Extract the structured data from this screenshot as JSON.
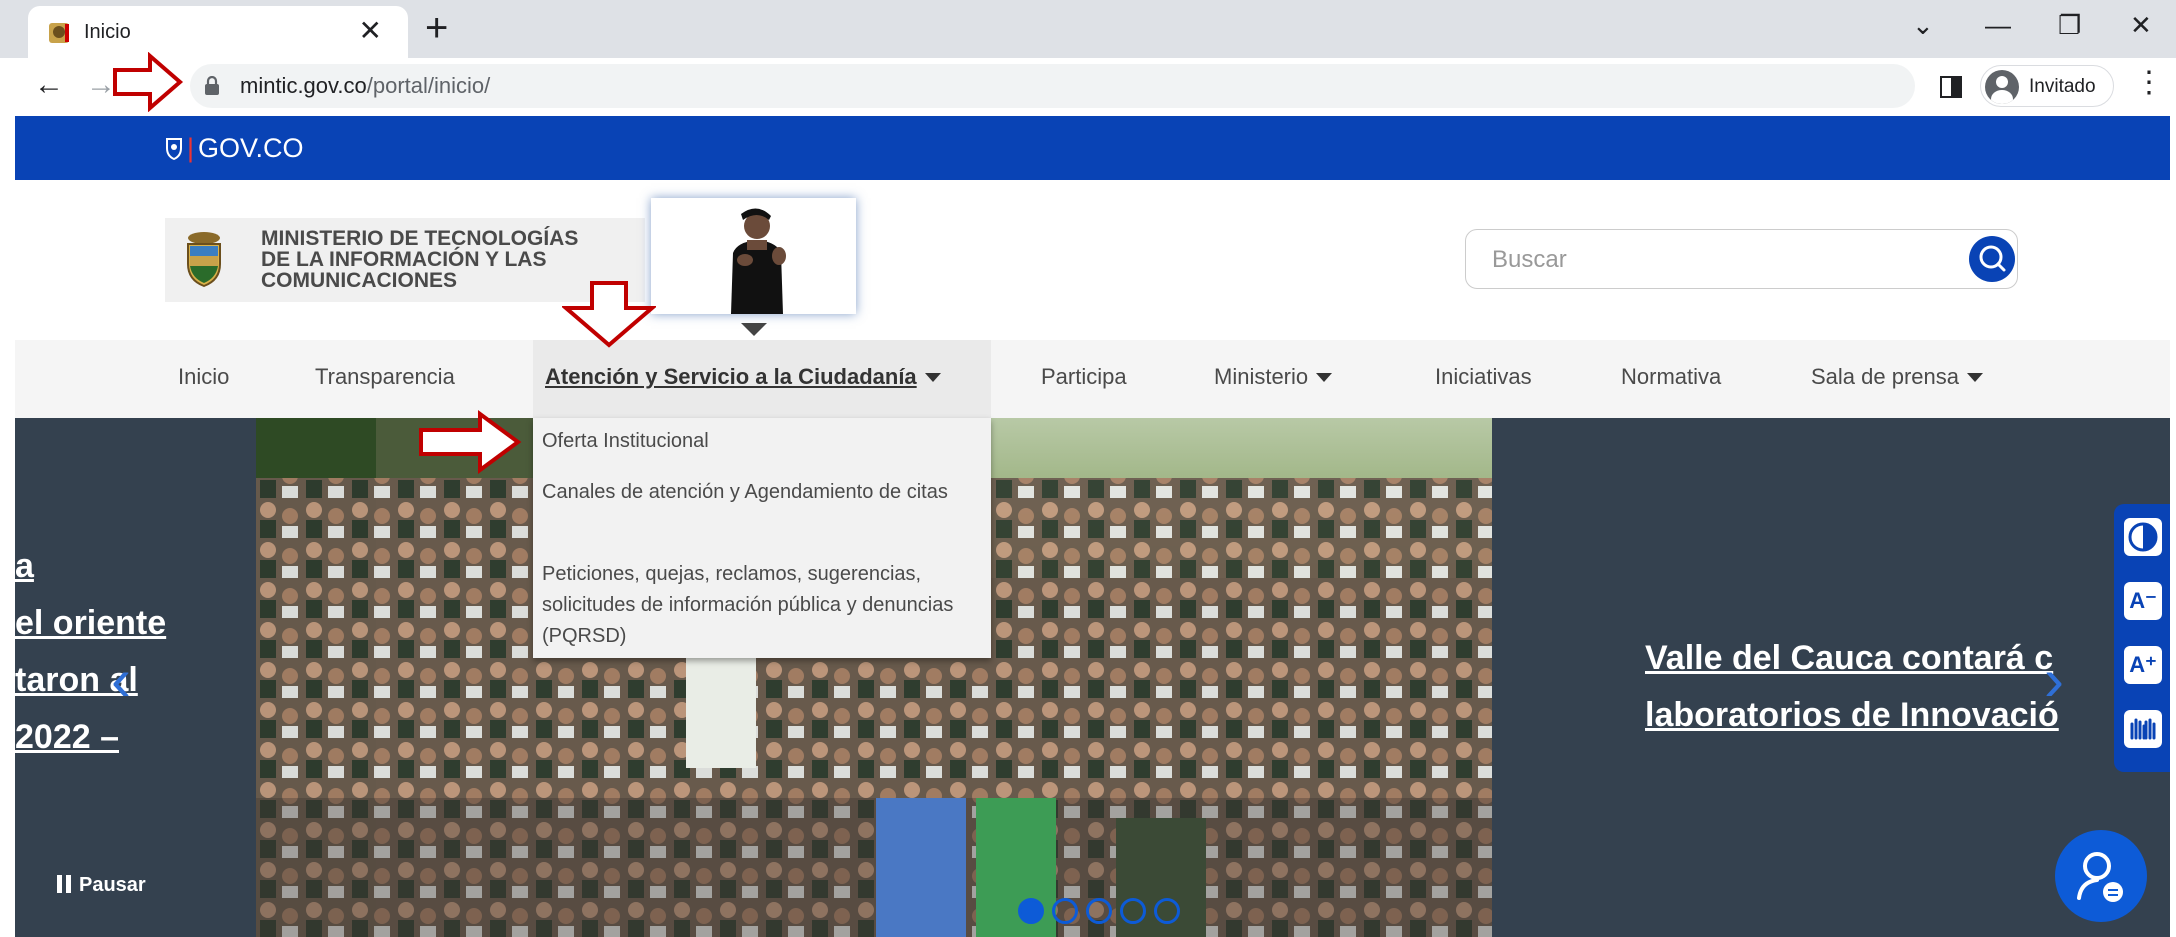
{
  "browser": {
    "tab_title": "Inicio",
    "tab_close": "✕",
    "new_tab": "+",
    "url_host": "mintic.gov.co",
    "url_path": "/portal/inicio/",
    "profile_label": "Invitado",
    "win_controls": [
      "⌄",
      "—",
      "❐",
      "✕"
    ]
  },
  "gov_bar": {
    "logo_text": "GOV.CO"
  },
  "header": {
    "ministry_name": [
      "MINISTERIO DE TECNOLOGÍAS",
      "DE LA INFORMACIÓN Y LAS",
      "COMUNICACIONES"
    ],
    "search_placeholder": "Buscar"
  },
  "nav": {
    "items": [
      {
        "label": "Inicio"
      },
      {
        "label": "Transparencia"
      },
      {
        "label": "Atención y Servicio a la Ciudadanía",
        "has_menu": true,
        "active": true
      },
      {
        "label": "Participa"
      },
      {
        "label": "Ministerio",
        "has_menu": true
      },
      {
        "label": "Iniciativas"
      },
      {
        "label": "Normativa"
      },
      {
        "label": "Sala de prensa",
        "has_menu": true
      }
    ]
  },
  "dropdown": {
    "items": [
      "Oferta Institucional",
      "Canales de atención y Agendamiento de citas",
      "Peticiones, quejas, reclamos, sugerencias, solicitudes de información pública y denuncias (PQRSD)"
    ]
  },
  "carousel": {
    "left_lines": [
      "a",
      "el oriente",
      "taron al",
      " 2022 –"
    ],
    "right_lines": [
      "Valle del Cauca contará c",
      "laboratorios de Innovació"
    ],
    "pause_label": "Pausar",
    "slide_count": 5,
    "active_slide": 1
  },
  "accessibility": {
    "buttons": [
      "contrast-icon",
      "decrease-font-icon",
      "increase-font-icon",
      "sign-language-icon"
    ],
    "decrease_label": "A⁻",
    "increase_label": "A⁺"
  },
  "colors": {
    "gov_blue": "#0943b5",
    "carousel_bg": "#34414f",
    "annotation_red": "#c00000"
  }
}
